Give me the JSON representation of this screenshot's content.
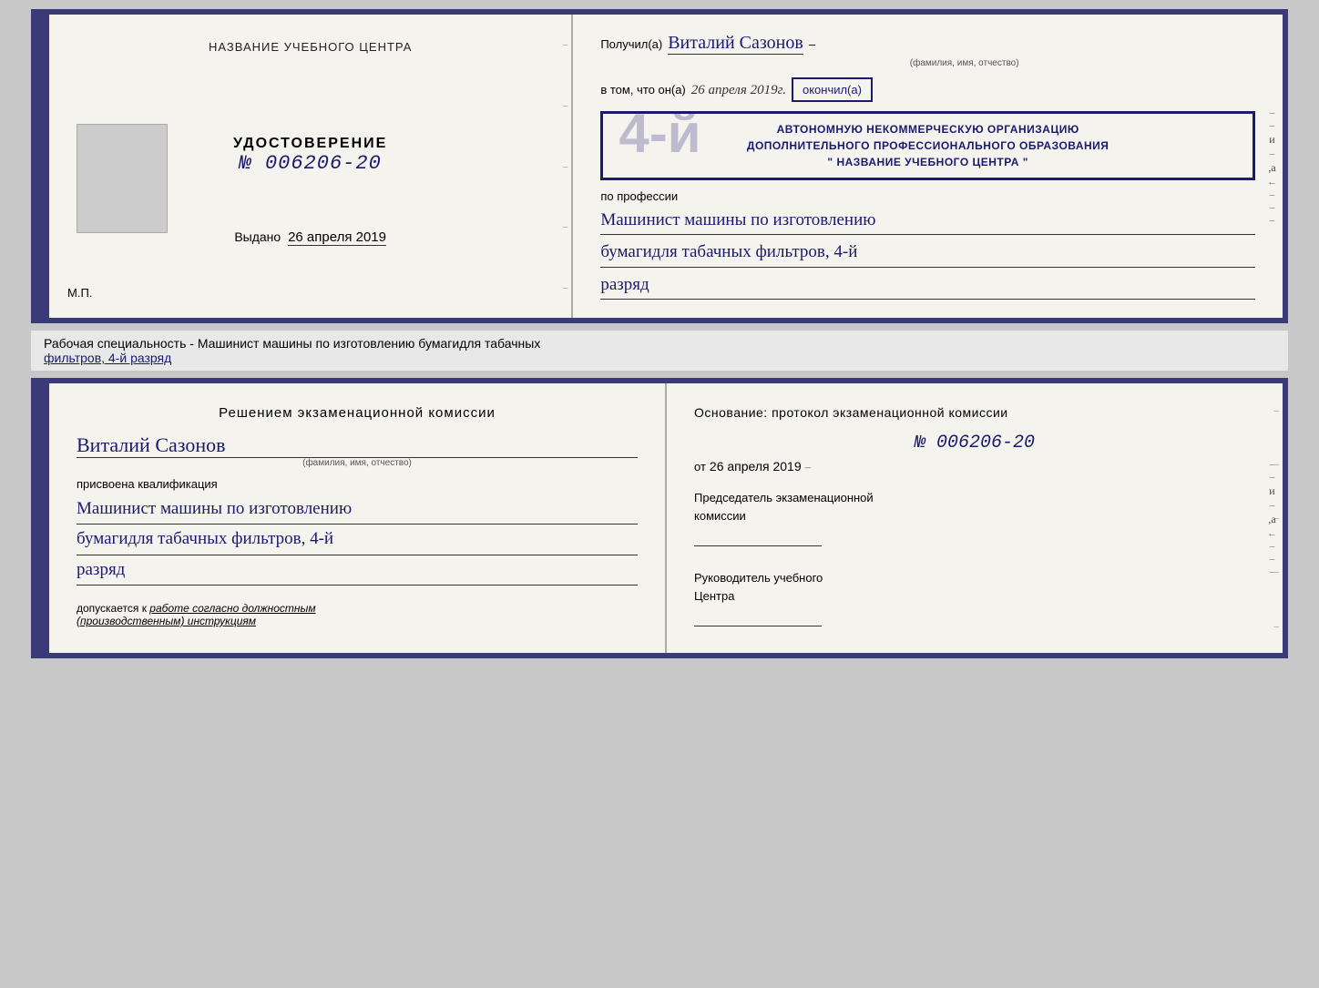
{
  "top_booklet": {
    "left_page": {
      "title": "НАЗВАНИЕ УЧЕБНОГО ЦЕНТРА",
      "photo_alt": "фото",
      "cert_word": "УДОСТОВЕРЕНИЕ",
      "cert_number_prefix": "№",
      "cert_number": "006206-20",
      "issued_label": "Выдано",
      "issued_date": "26 апреля 2019",
      "mp_label": "М.П."
    },
    "right_page": {
      "recipient_prefix": "Получил(а)",
      "recipient_name": "Виталий Сазонов",
      "recipient_sublabel": "(фамилия, имя, отчество)",
      "date_prefix": "в том, что он(а)",
      "date_value": "26 апреля 2019г.",
      "finished_label": "окончил(а)",
      "stamp_line1": "АВТОНОМНУЮ НЕКОММЕРЧЕСКУЮ ОРГАНИЗАЦИЮ",
      "stamp_line2": "ДОПОЛНИТЕЛЬНОГО ПРОФЕССИОНАЛЬНОГО ОБРАЗОВАНИЯ",
      "stamp_line3": "\" НАЗВАНИЕ УЧЕБНОГО ЦЕНТРА \"",
      "profession_label": "по профессии",
      "profession_line1": "Машинист машины по изготовлению",
      "profession_line2": "бумагидля табачных фильтров, 4-й",
      "profession_line3": "разряд"
    }
  },
  "middle_strip": {
    "text_prefix": "Рабочая специальность - Машинист машины по изготовлению бумагидля табачных",
    "text_underline": "фильтров, 4-й разряд"
  },
  "bottom_booklet": {
    "left_page": {
      "title": "Решением  экзаменационной  комиссии",
      "person_name": "Виталий Сазонов",
      "person_sublabel": "(фамилия, имя, отчество)",
      "assigned_label": "присвоена квалификация",
      "qualification_line1": "Машинист машины по изготовлению",
      "qualification_line2": "бумагидля табачных фильтров, 4-й",
      "qualification_line3": "разряд",
      "допуск_prefix": "допускается к",
      "допуск_italic": "работе согласно должностным",
      "допуск_italic2": "(производственным) инструкциям"
    },
    "right_page": {
      "basis_label": "Основание:  протокол  экзаменационной  комиссии",
      "number_prefix": "№",
      "number_value": "006206-20",
      "date_prefix": "от",
      "date_value": "26 апреля 2019",
      "chairman_label": "Председатель экзаменационной",
      "chairman_label2": "комиссии",
      "director_label": "Руководитель учебного",
      "director_label2": "Центра"
    }
  },
  "side_labels": {
    "и": "и",
    "а": "а",
    "arrow": "←"
  }
}
